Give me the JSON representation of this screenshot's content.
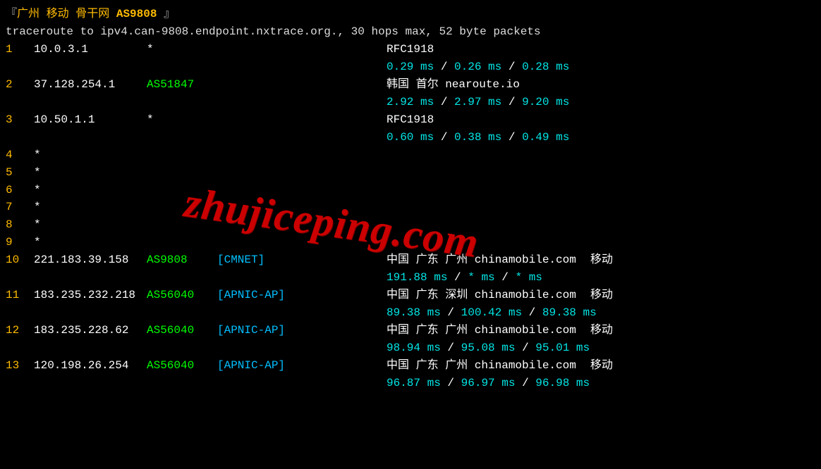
{
  "header": {
    "prefix": "『",
    "loc": "广州 移动 骨干网",
    "asn": "AS9808",
    "suffix": "』"
  },
  "cmd": "traceroute to ipv4.can-9808.endpoint.nxtrace.org., 30 hops max, 52 byte packets",
  "hops": [
    {
      "num": "1",
      "ip": "10.0.3.1",
      "asn": "*",
      "tag": "",
      "loc": "RFC1918",
      "isp_suffix": "",
      "timing": "0.29 ms / 0.26 ms / 0.28 ms"
    },
    {
      "num": "2",
      "ip": "37.128.254.1",
      "asn": "AS51847",
      "tag": "",
      "loc": "韩国 首尔   nearoute.io",
      "isp_suffix": "",
      "timing": "2.92 ms / 2.97 ms / 9.20 ms"
    },
    {
      "num": "3",
      "ip": "10.50.1.1",
      "asn": "*",
      "tag": "",
      "loc": "RFC1918",
      "isp_suffix": "",
      "timing": "0.60 ms / 0.38 ms / 0.49 ms"
    }
  ],
  "stars": [
    {
      "num": "4",
      "mark": "*"
    },
    {
      "num": "5",
      "mark": "*"
    },
    {
      "num": "6",
      "mark": "*"
    },
    {
      "num": "7",
      "mark": "*"
    },
    {
      "num": "8",
      "mark": "*"
    },
    {
      "num": "9",
      "mark": "*"
    }
  ],
  "hops2": [
    {
      "num": "10",
      "ip": "221.183.39.158",
      "asn": "AS9808",
      "tag": "[CMNET]",
      "loc": "中国 广东 广州  chinamobile.com",
      "isp_suffix": "移动",
      "timing": "191.88 ms / * ms / * ms"
    },
    {
      "num": "11",
      "ip": "183.235.232.218",
      "asn": "AS56040",
      "tag": "[APNIC-AP]",
      "loc": "中国 广东 深圳  chinamobile.com",
      "isp_suffix": "移动",
      "timing": "89.38 ms / 100.42 ms / 89.38 ms"
    },
    {
      "num": "12",
      "ip": "183.235.228.62",
      "asn": "AS56040",
      "tag": "[APNIC-AP]",
      "loc": "中国 广东 广州  chinamobile.com",
      "isp_suffix": "移动",
      "timing": "98.94 ms / 95.08 ms / 95.01 ms"
    },
    {
      "num": "13",
      "ip": "120.198.26.254",
      "asn": "AS56040",
      "tag": "[APNIC-AP]",
      "loc": "中国 广东 广州  chinamobile.com",
      "isp_suffix": "移动",
      "timing": "96.87 ms / 96.97 ms / 96.98 ms"
    }
  ],
  "watermark": "zhujiceping.com"
}
